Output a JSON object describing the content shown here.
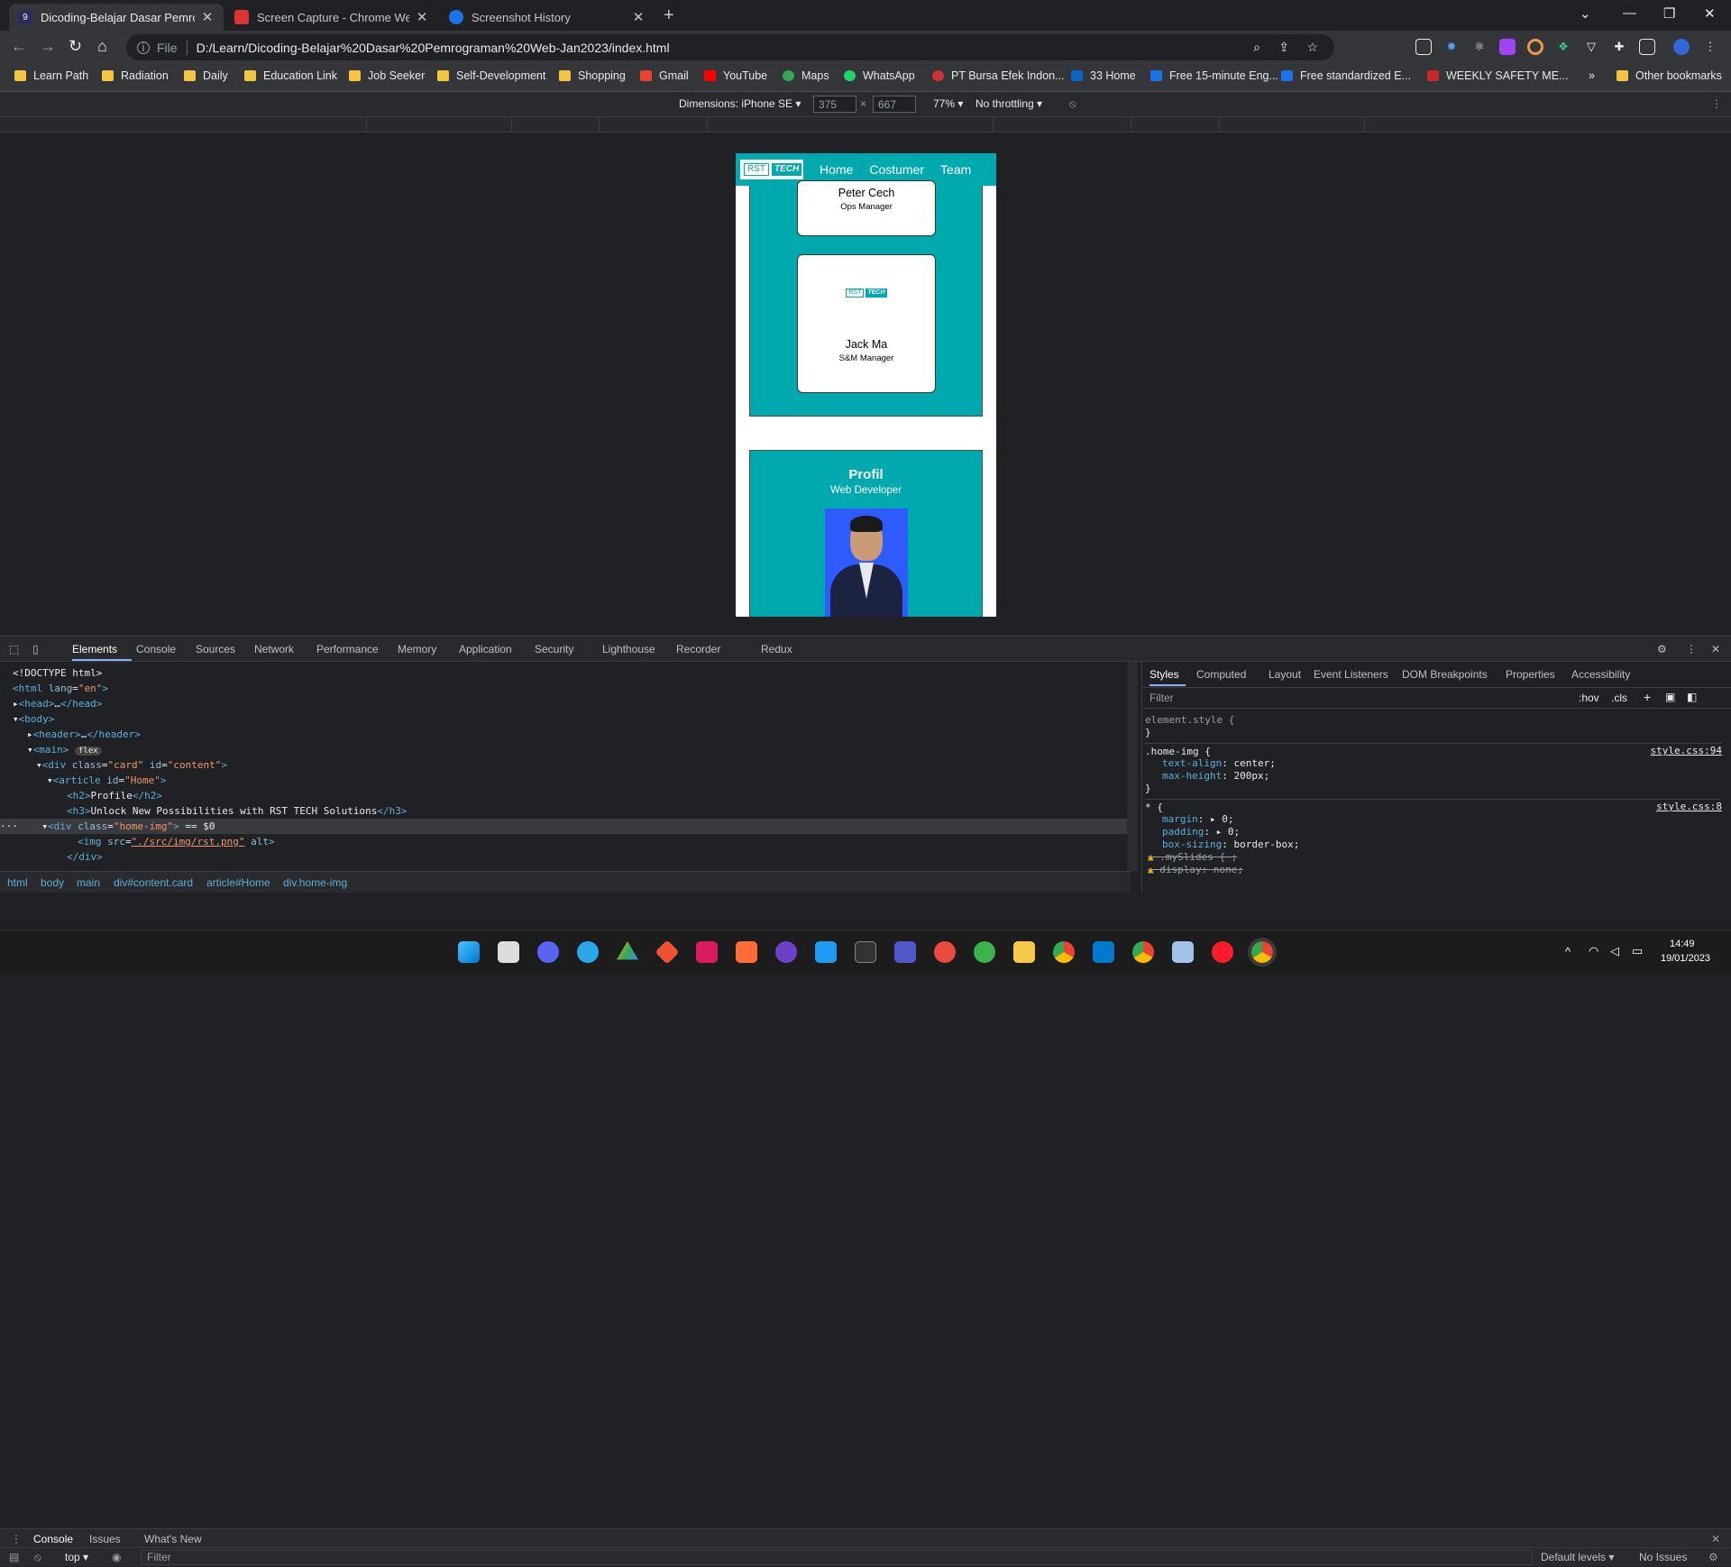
{
  "tabs": [
    {
      "title": "Dicoding-Belajar Dasar Pemrogra",
      "icon": "9"
    },
    {
      "title": "Screen Capture - Chrome Web St",
      "icon": ""
    },
    {
      "title": "Screenshot History",
      "icon": ""
    }
  ],
  "address": {
    "scheme": "File",
    "url": "D:/Learn/Dicoding-Belajar%20Dasar%20Pemrograman%20Web-Jan2023/index.html"
  },
  "bookmarks": [
    "Learn Path",
    "Radiation",
    "Daily",
    "Education Link",
    "Job Seeker",
    "Self-Development",
    "Shopping",
    "Gmail",
    "YouTube",
    "Maps",
    "WhatsApp",
    "PT Bursa Efek Indon...",
    "33 Home",
    "Free 15-minute Eng...",
    "Free standardized E...",
    "WEEKLY SAFETY ME...",
    "Other bookmarks"
  ],
  "device": {
    "dimensions": "Dimensions: iPhone SE",
    "width": "375",
    "height": "667",
    "zoom": "77%",
    "throttle": "No throttling"
  },
  "site": {
    "logo_a": "RST",
    "logo_b": "TECH",
    "nav": [
      "Home",
      "Costumer",
      "Team"
    ],
    "cards": [
      {
        "name": "Peter Cech",
        "role": "Ops Manager"
      },
      {
        "name": "Jack Ma",
        "role": "S&M Manager"
      }
    ],
    "profil": {
      "title": "Profil",
      "subtitle": "Web Developer"
    }
  },
  "devtools": {
    "tabs": [
      "Elements",
      "Console",
      "Sources",
      "Network",
      "Performance",
      "Memory",
      "Application",
      "Security",
      "Lighthouse",
      "Recorder",
      "Redux"
    ],
    "side_tabs": [
      "Styles",
      "Computed",
      "Layout",
      "Event Listeners",
      "DOM Breakpoints",
      "Properties",
      "Accessibility"
    ],
    "filter": "Filter",
    "hov": ":hov",
    ".cls": ".cls",
    "breadcrumbs": [
      "html",
      "body",
      "main",
      "div#content.card",
      "article#Home",
      "div.home-img"
    ],
    "drawer_tabs": [
      "Console",
      "Issues",
      "What's New"
    ],
    "context": "top",
    "default_levels": "Default levels",
    "no_issues": "No Issues"
  },
  "styles": {
    "element_style": "element.style {",
    "rule1_selector": ".home-img {",
    "rule1_src": "style.css:94",
    "rule1_props": [
      [
        "text-align",
        "center;"
      ],
      [
        "max-height",
        "200px;"
      ]
    ],
    "rule2_selector": "* {",
    "rule2_src": "style.css:8",
    "rule2_props": [
      [
        "margin",
        "0;"
      ],
      [
        "padding",
        "0;"
      ],
      [
        "box-sizing",
        "border-box;"
      ],
      [
        ".mySlides",
        "{ ;"
      ],
      [
        "display",
        "none;"
      ]
    ]
  },
  "clock": {
    "time": "14:49",
    "date": "19/01/2023"
  }
}
